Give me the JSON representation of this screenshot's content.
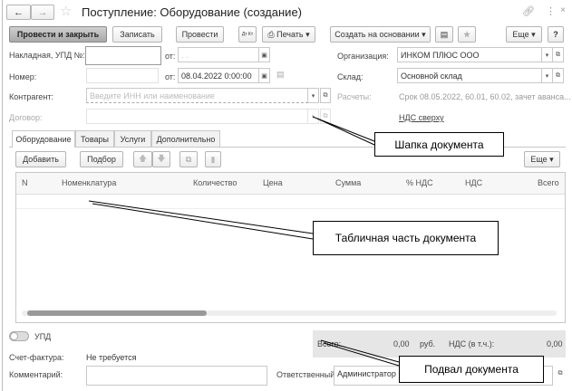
{
  "window": {
    "title": "Поступление: Оборудование (создание)"
  },
  "toolbar": {
    "post_close": "Провести и закрыть",
    "save": "Записать",
    "post": "Провести",
    "dtkt": "Дт Кт",
    "print": "Печать",
    "create_based": "Создать на основании",
    "more": "Еще",
    "help": "?"
  },
  "header": {
    "invoice_label": "Накладная, УПД №:",
    "invoice_value": "",
    "from_label": "от:",
    "invoice_date": " .  .",
    "number_label": "Номер:",
    "number_value": "",
    "date_value": "08.04.2022  0:00:00",
    "org_label": "Организация:",
    "org_value": "ИНКОМ ПЛЮС ООО",
    "warehouse_label": "Склад:",
    "warehouse_value": "Основной склад",
    "counterparty_label": "Контрагент:",
    "counterparty_placeholder": "Введите ИНН или наименование",
    "payments_label": "Расчеты:",
    "payments_value": "Срок 08.05.2022, 60.01, 60.02, зачет аванса...",
    "contract_label": "Договор:",
    "vat_link": "НДС сверху"
  },
  "tabs": [
    {
      "label": "Оборудование"
    },
    {
      "label": "Товары"
    },
    {
      "label": "Услуги"
    },
    {
      "label": "Дополнительно"
    }
  ],
  "table_toolbar": {
    "add": "Добавить",
    "pick": "Подбор",
    "more": "Еще"
  },
  "table": {
    "columns": [
      "N",
      "Номенклатура",
      "Количество",
      "Цена",
      "Сумма",
      "% НДС",
      "НДС",
      "Всего"
    ],
    "rows": []
  },
  "footer": {
    "upd_label": "УПД",
    "total_label": "Всего:",
    "total_value": "0,00",
    "currency": "руб.",
    "vat_label": "НДС (в т.ч.):",
    "vat_value": "0,00",
    "invoice_label": "Счет-фактура:",
    "invoice_value": "Не требуется",
    "comment_label": "Комментарий:",
    "comment_value": "",
    "responsible_label": "Ответственный:",
    "responsible_value": "Администратор"
  },
  "callouts": {
    "header": "Шапка документа",
    "table": "Табличная часть документа",
    "footer": "Подвал документа"
  }
}
